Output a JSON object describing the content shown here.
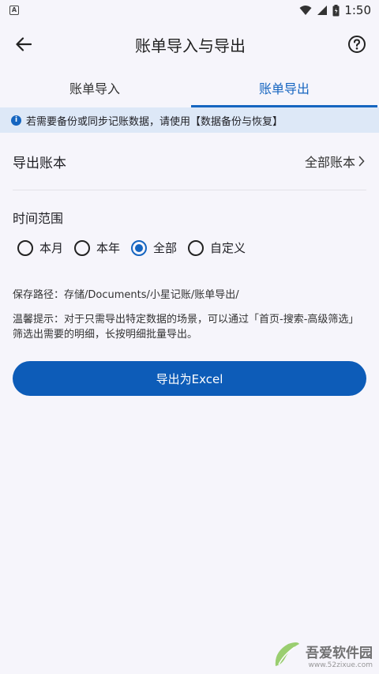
{
  "status_bar": {
    "notification_icon": "A",
    "time": "1:50",
    "icons": [
      "wifi-icon",
      "signal-icon",
      "battery-icon"
    ]
  },
  "app_bar": {
    "title": "账单导入与导出",
    "back_icon": "arrow-left-icon",
    "help_icon": "help-circle-icon"
  },
  "tabs": [
    {
      "label": "账单导入",
      "active": false
    },
    {
      "label": "账单导出",
      "active": true
    }
  ],
  "banner": {
    "text": "若需要备份或同步记账数据，请使用【数据备份与恢复】"
  },
  "export_book": {
    "label": "导出账本",
    "value": "全部账本"
  },
  "time_range": {
    "title": "时间范围",
    "options": [
      "本月",
      "本年",
      "全部",
      "自定义"
    ],
    "selected": "全部"
  },
  "save_path": "保存路径：存储/Documents/小星记账/账单导出/",
  "tip": "温馨提示：对于只需导出特定数据的场景，可以通过「首页-搜索-高级筛选」筛选出需要的明细，长按明细批量导出。",
  "export_button": "导出为Excel",
  "watermark": {
    "title": "吾爱软件园",
    "url": "www.52zixue.com"
  },
  "colors": {
    "accent": "#1565c0",
    "button": "#0d5cb8",
    "banner_bg": "#dde8f7",
    "page_bg": "#f6f5fb"
  }
}
